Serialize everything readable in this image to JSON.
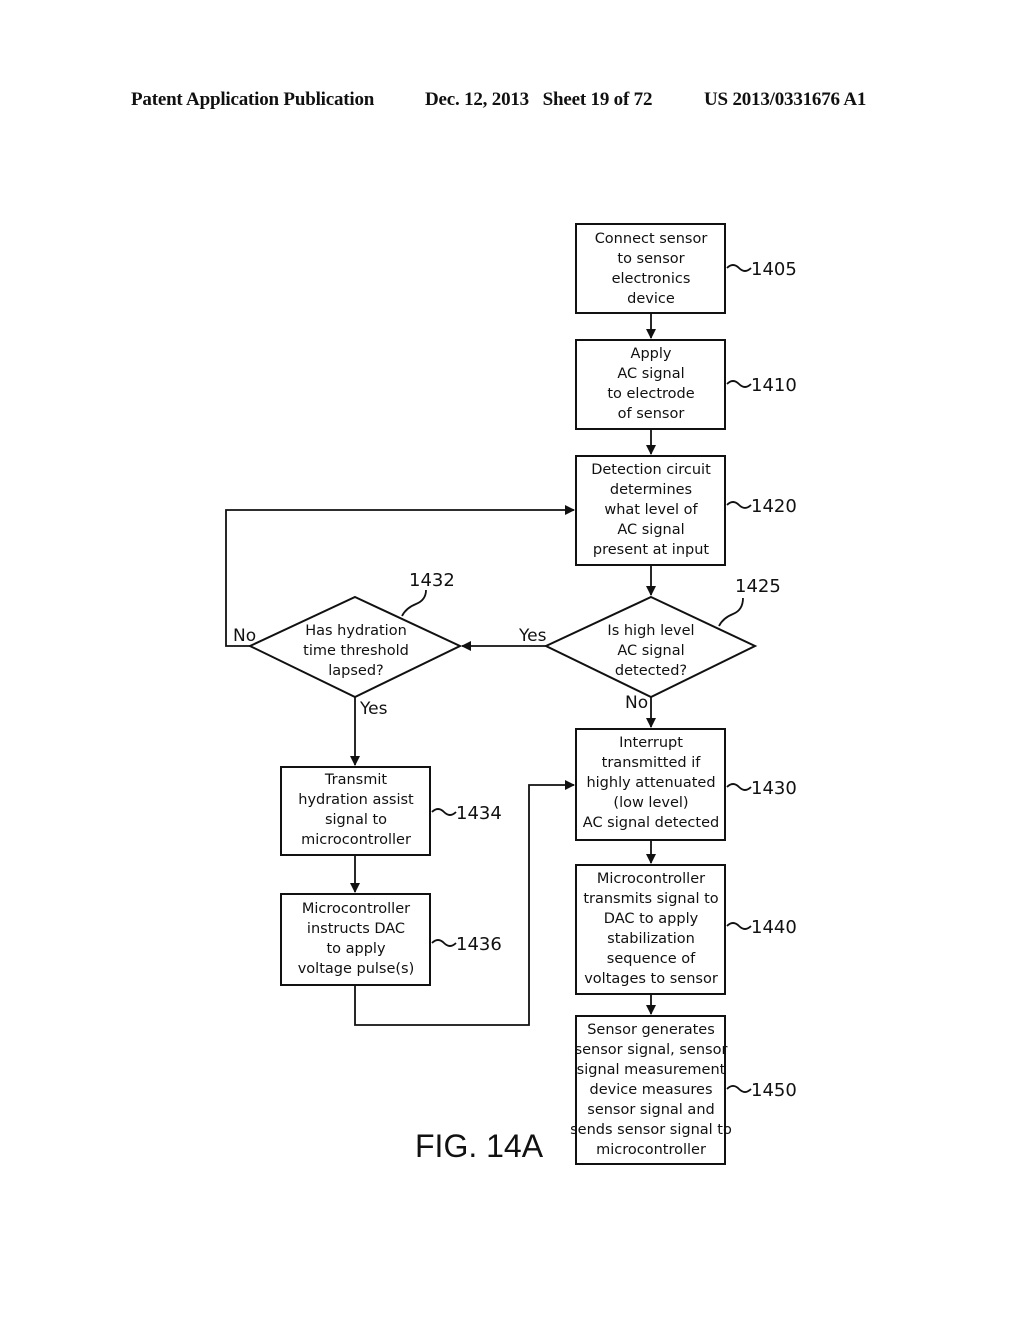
{
  "header": {
    "left": "Patent Application Publication",
    "middle": "Dec. 12, 2013   Sheet 19 of 72",
    "right": "US 2013/0331676 A1"
  },
  "figure_label": "FIG. 14A",
  "nodes": {
    "n1405": {
      "ref": "1405",
      "shape": "process",
      "lines": [
        "Connect sensor",
        "to sensor",
        "electronics",
        "device"
      ]
    },
    "n1410": {
      "ref": "1410",
      "shape": "process",
      "lines": [
        "Apply",
        "AC signal",
        "to electrode",
        "of sensor"
      ]
    },
    "n1420": {
      "ref": "1420",
      "shape": "process",
      "lines": [
        "Detection circuit",
        "determines",
        "what level of",
        "AC signal",
        "present at input"
      ]
    },
    "n1425": {
      "ref": "1425",
      "shape": "decision",
      "lines": [
        "Is high level",
        "AC signal",
        "detected?"
      ]
    },
    "n1432": {
      "ref": "1432",
      "shape": "decision",
      "lines": [
        "Has hydration",
        "time threshold",
        "lapsed?"
      ]
    },
    "n1434": {
      "ref": "1434",
      "shape": "process",
      "lines": [
        "Transmit",
        "hydration assist",
        "signal to",
        "microcontroller"
      ]
    },
    "n1436": {
      "ref": "1436",
      "shape": "process",
      "lines": [
        "Microcontroller",
        "instructs DAC",
        "to apply",
        "voltage pulse(s)"
      ]
    },
    "n1430": {
      "ref": "1430",
      "shape": "process",
      "lines": [
        "Interrupt",
        "transmitted if",
        "highly attenuated",
        "(low level)",
        "AC signal detected"
      ]
    },
    "n1440": {
      "ref": "1440",
      "shape": "process",
      "lines": [
        "Microcontroller",
        "transmits signal to",
        "DAC to apply",
        "stabilization",
        "sequence of",
        "voltages to sensor"
      ]
    },
    "n1450": {
      "ref": "1450",
      "shape": "process",
      "lines": [
        "Sensor generates",
        "sensor signal, sensor",
        "signal measurement",
        "device measures",
        "sensor signal and",
        "sends sensor signal to",
        "microcontroller"
      ]
    }
  },
  "edges": [
    {
      "from": "1405",
      "to": "1410",
      "label": ""
    },
    {
      "from": "1410",
      "to": "1420",
      "label": ""
    },
    {
      "from": "1420",
      "to": "1425",
      "label": ""
    },
    {
      "from": "1425",
      "to": "1432",
      "label": "Yes"
    },
    {
      "from": "1425",
      "to": "1430",
      "label": "No"
    },
    {
      "from": "1432",
      "to": "1420",
      "label": "No"
    },
    {
      "from": "1432",
      "to": "1434",
      "label": "Yes"
    },
    {
      "from": "1434",
      "to": "1436",
      "label": ""
    },
    {
      "from": "1436",
      "to": "1430",
      "label": ""
    },
    {
      "from": "1430",
      "to": "1440",
      "label": ""
    },
    {
      "from": "1440",
      "to": "1450",
      "label": ""
    }
  ],
  "edge_labels": {
    "yes_1425": "Yes",
    "no_1425": "No",
    "no_1432": "No",
    "yes_1432": "Yes"
  }
}
